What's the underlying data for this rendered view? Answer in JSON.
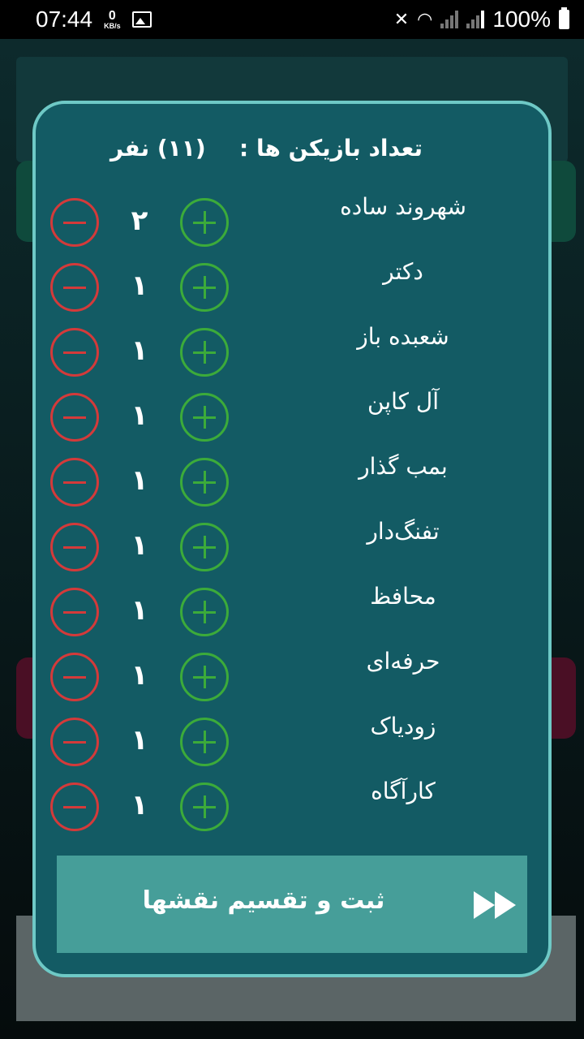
{
  "status_bar": {
    "time": "07:44",
    "net_speed_value": "0",
    "net_speed_unit": "KB/s",
    "battery": "100%"
  },
  "dialog": {
    "title": "تعداد بازیکن ها :",
    "player_count": "(۱۱) نفر",
    "roles": [
      {
        "name": "شهروند ساده",
        "count": "۲"
      },
      {
        "name": "دکتر",
        "count": "۱"
      },
      {
        "name": "شعبده باز",
        "count": "۱"
      },
      {
        "name": "آل کاپن",
        "count": "۱"
      },
      {
        "name": "بمب گذار",
        "count": "۱"
      },
      {
        "name": "تفنگ‌دار",
        "count": "۱"
      },
      {
        "name": "محافظ",
        "count": "۱"
      },
      {
        "name": "حرفه‌ای",
        "count": "۱"
      },
      {
        "name": "زودیاک",
        "count": "۱"
      },
      {
        "name": "کارآگاه",
        "count": "۱"
      }
    ],
    "submit_label": "ثبت و تقسیم نقشها"
  }
}
